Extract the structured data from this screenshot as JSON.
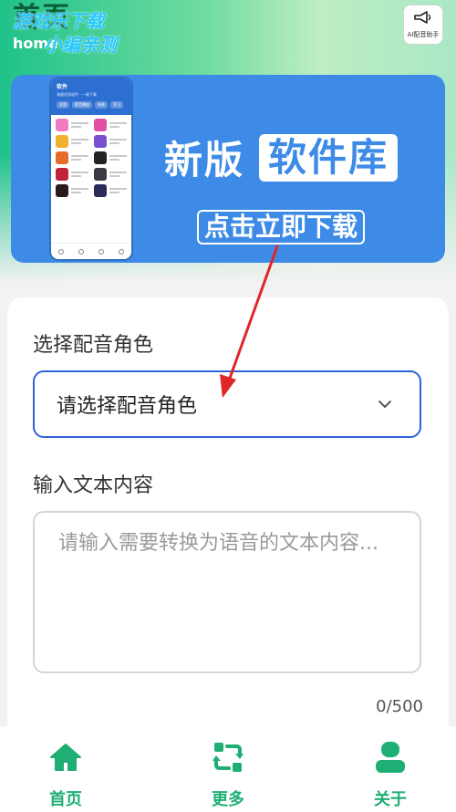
{
  "header": {
    "title": "首页",
    "subtitle": "home",
    "watermark_line1": "游戏乐下载",
    "watermark_line2": "小编亲测"
  },
  "ai_badge": {
    "icon": "megaphone-icon",
    "label": "AI配音助手"
  },
  "banner": {
    "title_plain": "新版",
    "title_highlight": "软件库",
    "cta": "点击立即下载",
    "bg_color": "#3d8be6",
    "phone": {
      "title": "软件",
      "subtitle": "海量优质软件 · 一键下载",
      "tabs": [
        "全部",
        "影音播放",
        "系统",
        "学习",
        "金融"
      ]
    }
  },
  "form": {
    "role_label": "选择配音角色",
    "role_select": {
      "placeholder": "请选择配音角色",
      "icon": "chevron-down-icon",
      "border_color": "#2e62d8"
    },
    "text_label": "输入文本内容",
    "text_input": {
      "placeholder": "请输入需要转换为语音的文本内容...",
      "value": ""
    },
    "counter": "0/500"
  },
  "tabbar": {
    "accent_color": "#1fae74",
    "items": [
      {
        "label": "首页",
        "icon": "home-icon"
      },
      {
        "label": "更多",
        "icon": "refresh-icon"
      },
      {
        "label": "关于",
        "icon": "user-icon"
      }
    ]
  },
  "annotation_arrow_color": "#e0262b"
}
